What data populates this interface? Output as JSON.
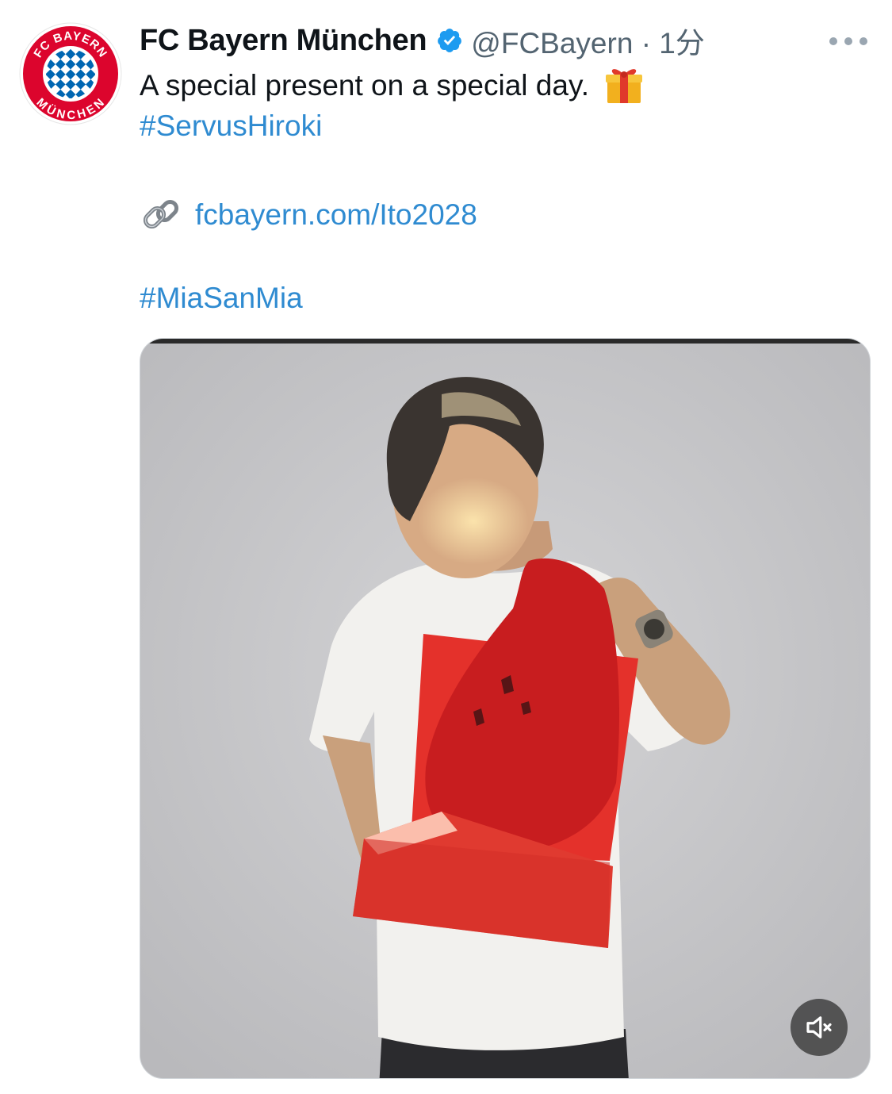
{
  "tweet": {
    "author_name": "FC Bayern München",
    "handle_time": "@FCBayern · 1分",
    "text_line1": "A special present on a special day.",
    "hashtag1": "#ServusHiroki",
    "link_text": "fcbayern.com/Ito2028",
    "hashtag2": "#MiaSanMia"
  },
  "logo": {
    "text_top": "FC BAYERN",
    "text_bottom": "MÜNCHEN"
  },
  "icons": {
    "verified": "verified-badge-icon",
    "gift": "gift-emoji-icon",
    "link": "link-emoji-icon",
    "more": "more-options-icon",
    "mute": "muted-speaker-icon"
  },
  "colors": {
    "link": "#2f8bd1",
    "verified": "#1d9bf0",
    "bayern_red": "#dc052d",
    "bayern_blue": "#0066b2"
  }
}
